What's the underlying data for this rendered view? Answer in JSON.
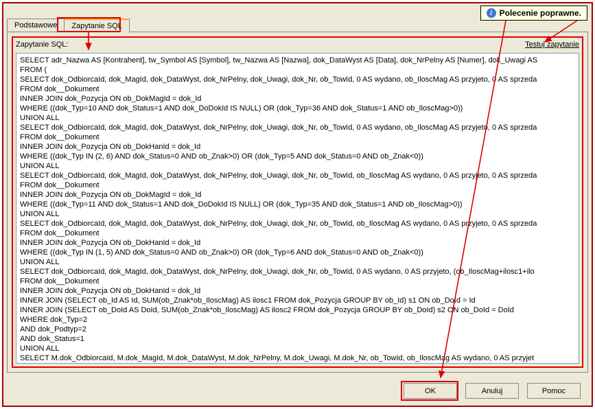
{
  "tooltip": {
    "text": "Polecenie poprawne."
  },
  "tabs": {
    "basic": "Podstawowe",
    "sql": "Zapytanie SQL"
  },
  "panel": {
    "label": "Zapytanie SQL:",
    "test_link": "Testuj zapytanie"
  },
  "sql": "SELECT adr_Nazwa AS [Kontrahent], tw_Symbol AS [Symbol], tw_Nazwa AS [Nazwa], dok_DataWyst AS [Data], dok_NrPelny AS [Numer], dok_Uwagi AS\nFROM (\nSELECT dok_OdbiorcaId, dok_MagId, dok_DataWyst, dok_NrPelny, dok_Uwagi, dok_Nr, ob_TowId, 0 AS wydano, ob_IloscMag AS przyjeto, 0 AS sprzeda\nFROM dok__Dokument\nINNER JOIN dok_Pozycja ON ob_DokMagId = dok_Id\nWHERE ((dok_Typ=10 AND dok_Status=1 AND dok_DoDokId IS NULL) OR (dok_Typ=36 AND dok_Status=1 AND ob_IloscMag>0))\nUNION ALL\nSELECT dok_OdbiorcaId, dok_MagId, dok_DataWyst, dok_NrPelny, dok_Uwagi, dok_Nr, ob_TowId, 0 AS wydano, ob_IloscMag AS przyjeto, 0 AS sprzeda\nFROM dok__Dokument\nINNER JOIN dok_Pozycja ON ob_DokHanId = dok_Id\nWHERE ((dok_Typ IN (2, 6) AND dok_Status=0 AND ob_Znak>0) OR (dok_Typ=5 AND dok_Status=0 AND ob_Znak<0))\nUNION ALL\nSELECT dok_OdbiorcaId, dok_MagId, dok_DataWyst, dok_NrPelny, dok_Uwagi, dok_Nr, ob_TowId, ob_IloscMag AS wydano, 0 AS przyjeto, 0 AS sprzeda\nFROM dok__Dokument\nINNER JOIN dok_Pozycja ON ob_DokMagId = dok_Id\nWHERE ((dok_Typ=11 AND dok_Status=1 AND dok_DoDokId IS NULL) OR (dok_Typ=35 AND dok_Status=1 AND ob_IloscMag>0))\nUNION ALL\nSELECT dok_OdbiorcaId, dok_MagId, dok_DataWyst, dok_NrPelny, dok_Uwagi, dok_Nr, ob_TowId, ob_IloscMag AS wydano, 0 AS przyjeto, 0 AS sprzeda\nFROM dok__Dokument\nINNER JOIN dok_Pozycja ON ob_DokHanId = dok_Id\nWHERE ((dok_Typ IN (1, 5) AND dok_Status=0 AND ob_Znak>0) OR (dok_Typ=6 AND dok_Status=0 AND ob_Znak<0))\nUNION ALL\nSELECT dok_OdbiorcaId, dok_MagId, dok_DataWyst, dok_NrPelny, dok_Uwagi, dok_Nr, ob_TowId, 0 AS wydano, 0 AS przyjeto, (ob_IloscMag+ilosc1+ilo\nFROM dok__Dokument\nINNER JOIN dok_Pozycja ON ob_DokHanId = dok_Id\nINNER JOIN (SELECT ob_Id AS Id, SUM(ob_Znak*ob_IloscMag) AS ilosc1 FROM dok_Pozycja GROUP BY ob_Id) s1 ON ob_DoId = Id\nINNER JOIN (SELECT ob_DoId AS DoId, SUM(ob_Znak*ob_IloscMag) AS ilosc2 FROM dok_Pozycja GROUP BY ob_DoId) s2 ON ob_DoId = DoId\nWHERE dok_Typ=2\nAND dok_Podtyp=2\nAND dok_Status=1\nUNION ALL\nSELECT M.dok_OdbiorcaId, M.dok_MagId, M.dok_DataWyst, M.dok_NrPelny, M.dok_Uwagi, M.dok_Nr, ob_TowId, ob_IloscMag AS wydano, 0 AS przyjet",
  "buttons": {
    "ok": "OK",
    "cancel": "Anuluj",
    "help": "Pomoc"
  }
}
